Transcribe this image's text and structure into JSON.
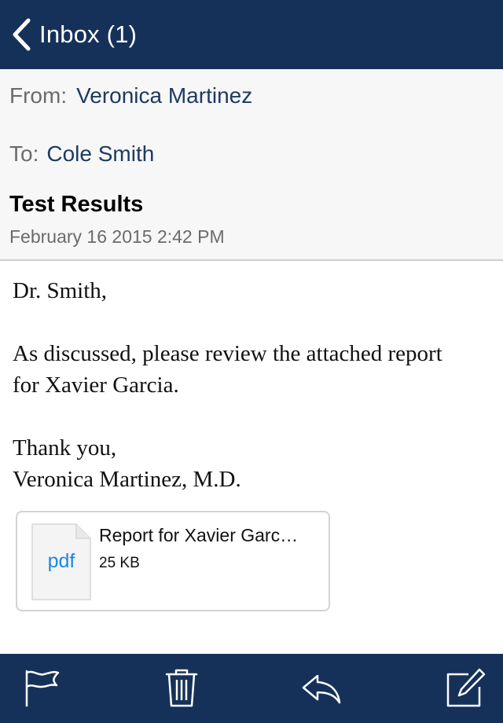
{
  "nav": {
    "back_label": "Inbox (1)"
  },
  "header": {
    "from_label": "From:",
    "from_value": "Veronica Martinez",
    "to_label": "To:",
    "to_value": "Cole Smith",
    "subject": "Test Results",
    "date": "February 16 2015 2:42 PM"
  },
  "body": {
    "greeting": "Dr. Smith,",
    "line1": "As discussed, please review the attached report",
    "line2": "for Xavier Garcia.",
    "closing": "Thank you,",
    "signature": "Veronica Martinez, M.D."
  },
  "attachment": {
    "file_type": "pdf",
    "name": "Report for Xavier Garc…",
    "size": "25 KB"
  },
  "toolbar": {
    "icons": [
      "flag-icon",
      "trash-icon",
      "reply-icon",
      "compose-icon"
    ]
  },
  "colors": {
    "nav_background": "#163159",
    "accent_text": "#1e3a62",
    "file_type": "#1f86e0"
  }
}
